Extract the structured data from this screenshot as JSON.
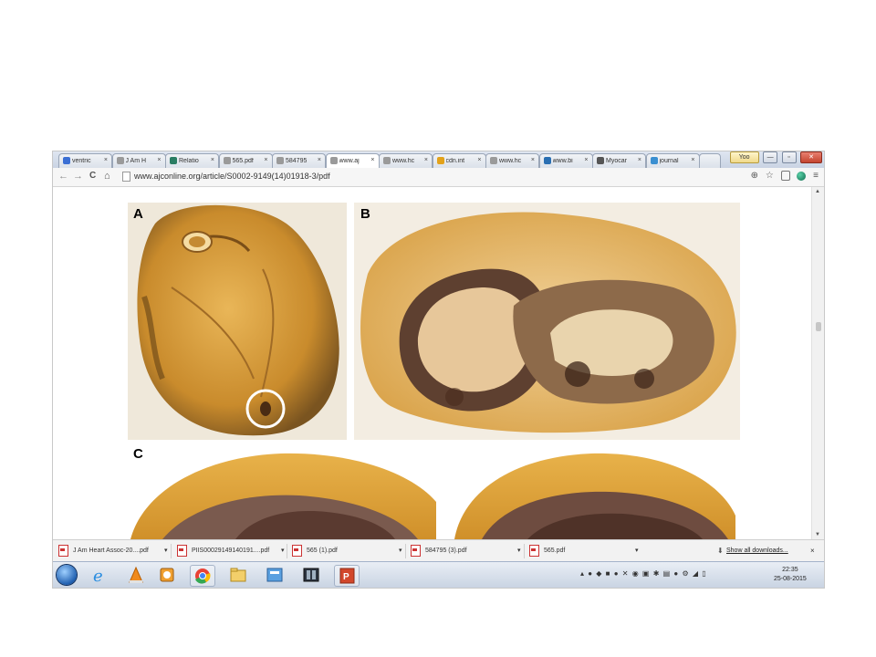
{
  "tabs": [
    {
      "label": "ventric",
      "icon": "google-icon",
      "color": "#3b6fd4"
    },
    {
      "label": "J Am H",
      "icon": "page-icon",
      "color": "#9a9a9a"
    },
    {
      "label": "Relatio",
      "icon": "ka-icon",
      "color": "#2a7d63"
    },
    {
      "label": "565.pdf",
      "icon": "page-icon",
      "color": "#9a9a9a"
    },
    {
      "label": "584795",
      "icon": "page-icon",
      "color": "#9a9a9a"
    },
    {
      "label": "www.aj",
      "icon": "page-icon",
      "color": "#9a9a9a",
      "active": true
    },
    {
      "label": "www.hc",
      "icon": "page-icon",
      "color": "#9a9a9a"
    },
    {
      "label": "cdn.int",
      "icon": "circle-icon",
      "color": "#e3a21a"
    },
    {
      "label": "www.hc",
      "icon": "page-icon",
      "color": "#9a9a9a"
    },
    {
      "label": "www.bi",
      "icon": "bird-icon",
      "color": "#2a6fb2"
    },
    {
      "label": "Myocar",
      "icon": "wikipedia-icon",
      "color": "#555555"
    },
    {
      "label": "journal",
      "icon": "stack-icon",
      "color": "#3a8fd1"
    }
  ],
  "tab_close": "×",
  "window": {
    "user": "Yoo",
    "minimize": "—",
    "restore": "▫",
    "close": "✕"
  },
  "toolbar": {
    "back": "←",
    "forward": "→",
    "reload": "C",
    "home": "⌂",
    "url": "www.ajconline.org/article/S0002-9149(14)01918-3/pdf",
    "zoom": "⊕",
    "star": "☆",
    "menu": "≡"
  },
  "figure": {
    "panels": [
      "A",
      "B",
      "C"
    ]
  },
  "downloads": [
    {
      "name": "J Am Heart Assoc-20....pdf"
    },
    {
      "name": "PIIS00029149140191....pdf"
    },
    {
      "name": "565 (1).pdf"
    },
    {
      "name": "584795 (3).pdf"
    },
    {
      "name": "565.pdf"
    }
  ],
  "show_all": "Show all downloads...",
  "shelf_close": "×",
  "taskbar": {
    "time": "22:35",
    "date": "25-08-2015"
  },
  "colors": {
    "accent": "#3b6fd4",
    "tissue_yellow": "#d9a646",
    "tissue_dark": "#5a3b2d"
  }
}
